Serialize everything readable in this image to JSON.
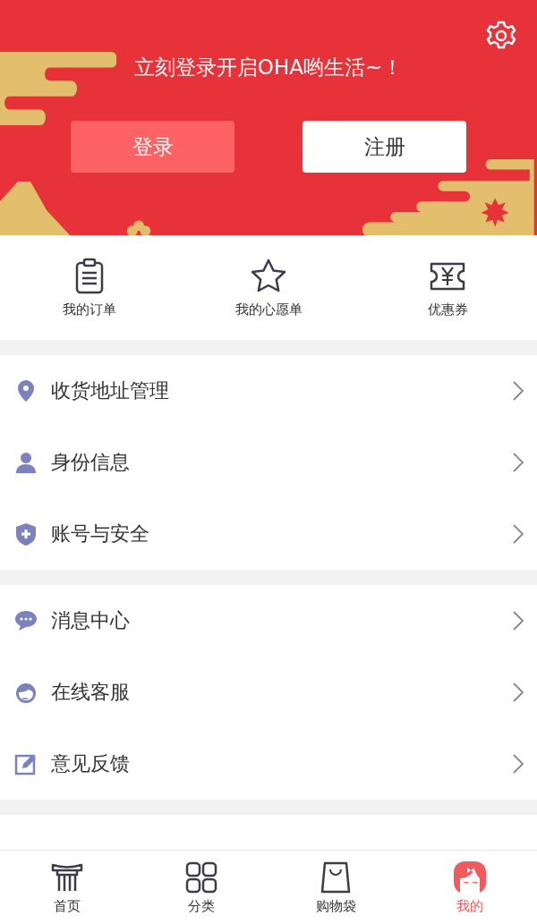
{
  "header": {
    "slogan": "立刻登录开启OHA哟生活~！",
    "buttons": [
      {
        "label": "登录",
        "kind": "primary"
      },
      {
        "label": "注册",
        "kind": "secondary"
      }
    ]
  },
  "shortcuts": [
    {
      "label": "我的订单",
      "kind": "order"
    },
    {
      "label": "我的心愿单",
      "kind": "wishlist"
    },
    {
      "label": "优惠券",
      "kind": "coupon"
    }
  ],
  "menu_groups": [
    [
      {
        "label": "收货地址管理",
        "kind": "location"
      },
      {
        "label": "身份信息",
        "kind": "person"
      },
      {
        "label": "账号与安全",
        "kind": "shield"
      }
    ],
    [
      {
        "label": "消息中心",
        "kind": "message"
      },
      {
        "label": "在线客服",
        "kind": "service"
      },
      {
        "label": "意见反馈",
        "kind": "feedback"
      }
    ]
  ],
  "tabs": [
    {
      "label": "首页",
      "kind": "home",
      "selected": false
    },
    {
      "label": "分类",
      "kind": "category",
      "selected": false
    },
    {
      "label": "购物袋",
      "kind": "bag",
      "selected": false
    },
    {
      "label": "我的",
      "kind": "me",
      "selected": true
    }
  ]
}
